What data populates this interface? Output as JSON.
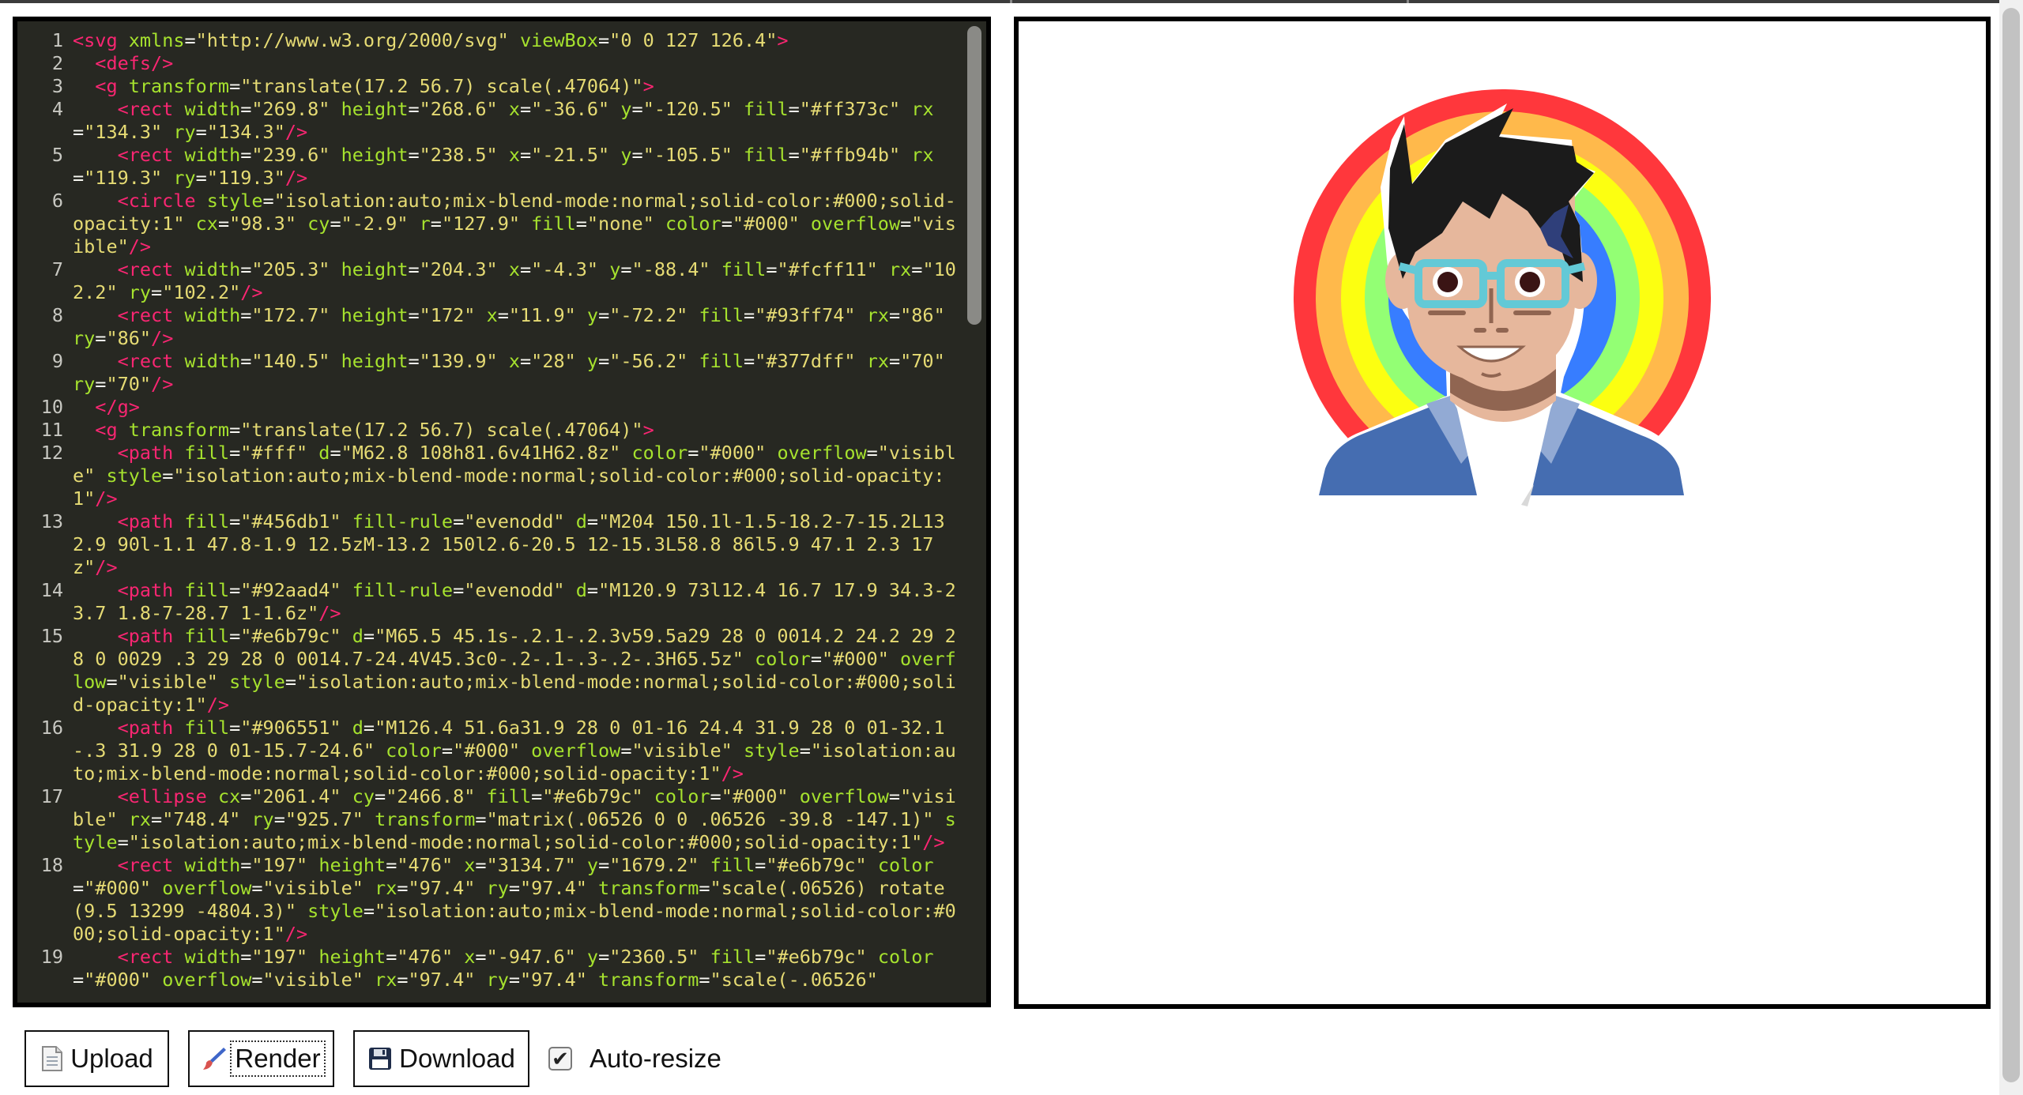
{
  "editor": {
    "lines": [
      {
        "num": "1",
        "html": "<span class=\"t\">&lt;svg</span> <span class=\"a\">xmlns</span>=<span class=\"s\">\"http://www.w3.org/2000/svg\"</span> <span class=\"a\">viewBox</span>=<span class=\"s\">\"0 0 127 126.4\"</span><span class=\"t\">&gt;</span>"
      },
      {
        "num": "2",
        "html": "  <span class=\"t\">&lt;defs/&gt;</span>"
      },
      {
        "num": "3",
        "html": "  <span class=\"t\">&lt;g</span> <span class=\"a\">transform</span>=<span class=\"s\">\"translate(17.2 56.7) scale(.47064)\"</span><span class=\"t\">&gt;</span>"
      },
      {
        "num": "4",
        "html": "    <span class=\"t\">&lt;rect</span> <span class=\"a\">width</span>=<span class=\"s\">\"269.8\"</span> <span class=\"a\">height</span>=<span class=\"s\">\"268.6\"</span> <span class=\"a\">x</span>=<span class=\"s\">\"-36.6\"</span> <span class=\"a\">y</span>=<span class=\"s\">\"-120.5\"</span> <span class=\"a\">fill</span>=<span class=\"s\">\"#ff373c\"</span> <span class=\"a\">rx</span>=<span class=\"s\">\"134.3\"</span> <span class=\"a\">ry</span>=<span class=\"s\">\"134.3\"</span><span class=\"t\">/&gt;</span>"
      },
      {
        "num": "5",
        "html": "    <span class=\"t\">&lt;rect</span> <span class=\"a\">width</span>=<span class=\"s\">\"239.6\"</span> <span class=\"a\">height</span>=<span class=\"s\">\"238.5\"</span> <span class=\"a\">x</span>=<span class=\"s\">\"-21.5\"</span> <span class=\"a\">y</span>=<span class=\"s\">\"-105.5\"</span> <span class=\"a\">fill</span>=<span class=\"s\">\"#ffb94b\"</span> <span class=\"a\">rx</span>=<span class=\"s\">\"119.3\"</span> <span class=\"a\">ry</span>=<span class=\"s\">\"119.3\"</span><span class=\"t\">/&gt;</span>"
      },
      {
        "num": "6",
        "html": "    <span class=\"t\">&lt;circle</span> <span class=\"a\">style</span>=<span class=\"s\">\"isolation:auto;mix-blend-mode:normal;solid-color:#000;solid-opacity:1\"</span> <span class=\"a\">cx</span>=<span class=\"s\">\"98.3\"</span> <span class=\"a\">cy</span>=<span class=\"s\">\"-2.9\"</span> <span class=\"a\">r</span>=<span class=\"s\">\"127.9\"</span> <span class=\"a\">fill</span>=<span class=\"s\">\"none\"</span> <span class=\"a\">color</span>=<span class=\"s\">\"#000\"</span> <span class=\"a\">overflow</span>=<span class=\"s\">\"visible\"</span><span class=\"t\">/&gt;</span>"
      },
      {
        "num": "7",
        "html": "    <span class=\"t\">&lt;rect</span> <span class=\"a\">width</span>=<span class=\"s\">\"205.3\"</span> <span class=\"a\">height</span>=<span class=\"s\">\"204.3\"</span> <span class=\"a\">x</span>=<span class=\"s\">\"-4.3\"</span> <span class=\"a\">y</span>=<span class=\"s\">\"-88.4\"</span> <span class=\"a\">fill</span>=<span class=\"s\">\"#fcff11\"</span> <span class=\"a\">rx</span>=<span class=\"s\">\"102.2\"</span> <span class=\"a\">ry</span>=<span class=\"s\">\"102.2\"</span><span class=\"t\">/&gt;</span>"
      },
      {
        "num": "8",
        "html": "    <span class=\"t\">&lt;rect</span> <span class=\"a\">width</span>=<span class=\"s\">\"172.7\"</span> <span class=\"a\">height</span>=<span class=\"s\">\"172\"</span> <span class=\"a\">x</span>=<span class=\"s\">\"11.9\"</span> <span class=\"a\">y</span>=<span class=\"s\">\"-72.2\"</span> <span class=\"a\">fill</span>=<span class=\"s\">\"#93ff74\"</span> <span class=\"a\">rx</span>=<span class=\"s\">\"86\"</span> <span class=\"a\">ry</span>=<span class=\"s\">\"86\"</span><span class=\"t\">/&gt;</span>"
      },
      {
        "num": "9",
        "html": "    <span class=\"t\">&lt;rect</span> <span class=\"a\">width</span>=<span class=\"s\">\"140.5\"</span> <span class=\"a\">height</span>=<span class=\"s\">\"139.9\"</span> <span class=\"a\">x</span>=<span class=\"s\">\"28\"</span> <span class=\"a\">y</span>=<span class=\"s\">\"-56.2\"</span> <span class=\"a\">fill</span>=<span class=\"s\">\"#377dff\"</span> <span class=\"a\">rx</span>=<span class=\"s\">\"70\"</span> <span class=\"a\">ry</span>=<span class=\"s\">\"70\"</span><span class=\"t\">/&gt;</span>"
      },
      {
        "num": "10",
        "html": "  <span class=\"t\">&lt;/g&gt;</span>"
      },
      {
        "num": "11",
        "html": "  <span class=\"t\">&lt;g</span> <span class=\"a\">transform</span>=<span class=\"s\">\"translate(17.2 56.7) scale(.47064)\"</span><span class=\"t\">&gt;</span>"
      },
      {
        "num": "12",
        "html": "    <span class=\"t\">&lt;path</span> <span class=\"a\">fill</span>=<span class=\"s\">\"#fff\"</span> <span class=\"a\">d</span>=<span class=\"s\">\"M62.8 108h81.6v41H62.8z\"</span> <span class=\"a\">color</span>=<span class=\"s\">\"#000\"</span> <span class=\"a\">overflow</span>=<span class=\"s\">\"visible\"</span> <span class=\"a\">style</span>=<span class=\"s\">\"isolation:auto;mix-blend-mode:normal;solid-color:#000;solid-opacity:1\"</span><span class=\"t\">/&gt;</span>"
      },
      {
        "num": "13",
        "html": "    <span class=\"t\">&lt;path</span> <span class=\"a\">fill</span>=<span class=\"s\">\"#456db1\"</span> <span class=\"a\">fill-rule</span>=<span class=\"s\">\"evenodd\"</span> <span class=\"a\">d</span>=<span class=\"s\">\"M204 150.1l-1.5-18.2-7-15.2L132.9 90l-1.1 47.8-1.9 12.5zM-13.2 150l2.6-20.5 12-15.3L58.8 86l5.9 47.1 2.3 17z\"</span><span class=\"t\">/&gt;</span>"
      },
      {
        "num": "14",
        "html": "    <span class=\"t\">&lt;path</span> <span class=\"a\">fill</span>=<span class=\"s\">\"#92aad4\"</span> <span class=\"a\">fill-rule</span>=<span class=\"s\">\"evenodd\"</span> <span class=\"a\">d</span>=<span class=\"s\">\"M120.9 73l12.4 16.7 17.9 34.3-23.7 1.8-7-28.7 1-1.6z\"</span><span class=\"t\">/&gt;</span>"
      },
      {
        "num": "15",
        "html": "    <span class=\"t\">&lt;path</span> <span class=\"a\">fill</span>=<span class=\"s\">\"#e6b79c\"</span> <span class=\"a\">d</span>=<span class=\"s\">\"M65.5 45.1s-.2.1-.2.3v59.5a29 28 0 0014.2 24.2 29 28 0 0029 .3 29 28 0 0014.7-24.4V45.3c0-.2-.1-.3-.2-.3H65.5z\"</span> <span class=\"a\">color</span>=<span class=\"s\">\"#000\"</span> <span class=\"a\">overflow</span>=<span class=\"s\">\"visible\"</span> <span class=\"a\">style</span>=<span class=\"s\">\"isolation:auto;mix-blend-mode:normal;solid-color:#000;solid-opacity:1\"</span><span class=\"t\">/&gt;</span>"
      },
      {
        "num": "16",
        "html": "    <span class=\"t\">&lt;path</span> <span class=\"a\">fill</span>=<span class=\"s\">\"#906551\"</span> <span class=\"a\">d</span>=<span class=\"s\">\"M126.4 51.6a31.9 28 0 01-16 24.4 31.9 28 0 01-32.1-.3 31.9 28 0 01-15.7-24.6\"</span> <span class=\"a\">color</span>=<span class=\"s\">\"#000\"</span> <span class=\"a\">overflow</span>=<span class=\"s\">\"visible\"</span> <span class=\"a\">style</span>=<span class=\"s\">\"isolation:auto;mix-blend-mode:normal;solid-color:#000;solid-opacity:1\"</span><span class=\"t\">/&gt;</span>"
      },
      {
        "num": "17",
        "html": "    <span class=\"t\">&lt;ellipse</span> <span class=\"a\">cx</span>=<span class=\"s\">\"2061.4\"</span> <span class=\"a\">cy</span>=<span class=\"s\">\"2466.8\"</span> <span class=\"a\">fill</span>=<span class=\"s\">\"#e6b79c\"</span> <span class=\"a\">color</span>=<span class=\"s\">\"#000\"</span> <span class=\"a\">overflow</span>=<span class=\"s\">\"visible\"</span> <span class=\"a\">rx</span>=<span class=\"s\">\"748.4\"</span> <span class=\"a\">ry</span>=<span class=\"s\">\"925.7\"</span> <span class=\"a\">transform</span>=<span class=\"s\">\"matrix(.06526 0 0 .06526 -39.8 -147.1)\"</span> <span class=\"a\">style</span>=<span class=\"s\">\"isolation:auto;mix-blend-mode:normal;solid-color:#000;solid-opacity:1\"</span><span class=\"t\">/&gt;</span>"
      },
      {
        "num": "18",
        "html": "    <span class=\"t\">&lt;rect</span> <span class=\"a\">width</span>=<span class=\"s\">\"197\"</span> <span class=\"a\">height</span>=<span class=\"s\">\"476\"</span> <span class=\"a\">x</span>=<span class=\"s\">\"3134.7\"</span> <span class=\"a\">y</span>=<span class=\"s\">\"1679.2\"</span> <span class=\"a\">fill</span>=<span class=\"s\">\"#e6b79c\"</span> <span class=\"a\">color</span>=<span class=\"s\">\"#000\"</span> <span class=\"a\">overflow</span>=<span class=\"s\">\"visible\"</span> <span class=\"a\">rx</span>=<span class=\"s\">\"97.4\"</span> <span class=\"a\">ry</span>=<span class=\"s\">\"97.4\"</span> <span class=\"a\">transform</span>=<span class=\"s\">\"scale(.06526) rotate(9.5 13299 -4804.3)\"</span> <span class=\"a\">style</span>=<span class=\"s\">\"isolation:auto;mix-blend-mode:normal;solid-color:#000;solid-opacity:1\"</span><span class=\"t\">/&gt;</span>"
      },
      {
        "num": "19",
        "html": "    <span class=\"t\">&lt;rect</span> <span class=\"a\">width</span>=<span class=\"s\">\"197\"</span> <span class=\"a\">height</span>=<span class=\"s\">\"476\"</span> <span class=\"a\">x</span>=<span class=\"s\">\"-947.6\"</span> <span class=\"a\">y</span>=<span class=\"s\">\"2360.5\"</span> <span class=\"a\">fill</span>=<span class=\"s\">\"#e6b79c\"</span> <span class=\"a\">color</span>=<span class=\"s\">\"#000\"</span> <span class=\"a\">overflow</span>=<span class=\"s\">\"visible\"</span> <span class=\"a\">rx</span>=<span class=\"s\">\"97.4\"</span> <span class=\"a\">ry</span>=<span class=\"s\">\"97.4\"</span> <span class=\"a\">transform</span>=<span class=\"s\">\"scale(-.06526\"</span>"
      }
    ]
  },
  "preview": {
    "rainbow_colors": [
      "#ff373c",
      "#ffb94b",
      "#fcff11",
      "#93ff74",
      "#377dff"
    ],
    "colors": {
      "hair": "#1b1b1b",
      "skin": "#e6b79c",
      "shadow": "#906551",
      "jacket": "#456db1",
      "collar": "#92aad4",
      "glasses": "#63c9d6",
      "eyes": "#3a1414"
    }
  },
  "toolbar": {
    "upload_label": "Upload",
    "upload_icon": "document-icon",
    "render_label": "Render",
    "render_icon": "brush-icon",
    "download_label": "Download",
    "download_icon": "floppy-disk-icon",
    "autoresize_label": "Auto-resize",
    "autoresize_checked": true
  }
}
